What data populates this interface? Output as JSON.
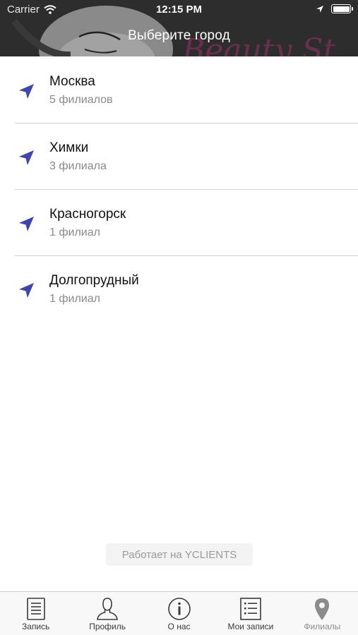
{
  "status_bar": {
    "carrier": "Carrier",
    "time": "12:15 PM"
  },
  "header": {
    "title": "Выберите город",
    "background_text": "Beauty St"
  },
  "cities": [
    {
      "name": "Москва",
      "count": "5 филиалов",
      "icon": "location-arrow-icon"
    },
    {
      "name": "Химки",
      "count": "3 филиала",
      "icon": "location-arrow-icon"
    },
    {
      "name": "Красногорск",
      "count": "1 филиал",
      "icon": "location-arrow-icon"
    },
    {
      "name": "Долгопрудный",
      "count": "1 филиал",
      "icon": "location-arrow-icon"
    }
  ],
  "powered_by": "Работает на YCLIENTS",
  "tabs": [
    {
      "label": "Запись",
      "icon": "document-icon",
      "active": false
    },
    {
      "label": "Профиль",
      "icon": "user-icon",
      "active": false
    },
    {
      "label": "О нас",
      "icon": "info-icon",
      "active": false
    },
    {
      "label": "Мои записи",
      "icon": "list-icon",
      "active": false
    },
    {
      "label": "Филиалы",
      "icon": "map-pin-icon",
      "active": true
    }
  ],
  "colors": {
    "header_bg": "#2e2d2e",
    "accent": "#3b46b0",
    "tab_inactive": "#3a3a3a",
    "tab_active": "#8c8c8c"
  }
}
